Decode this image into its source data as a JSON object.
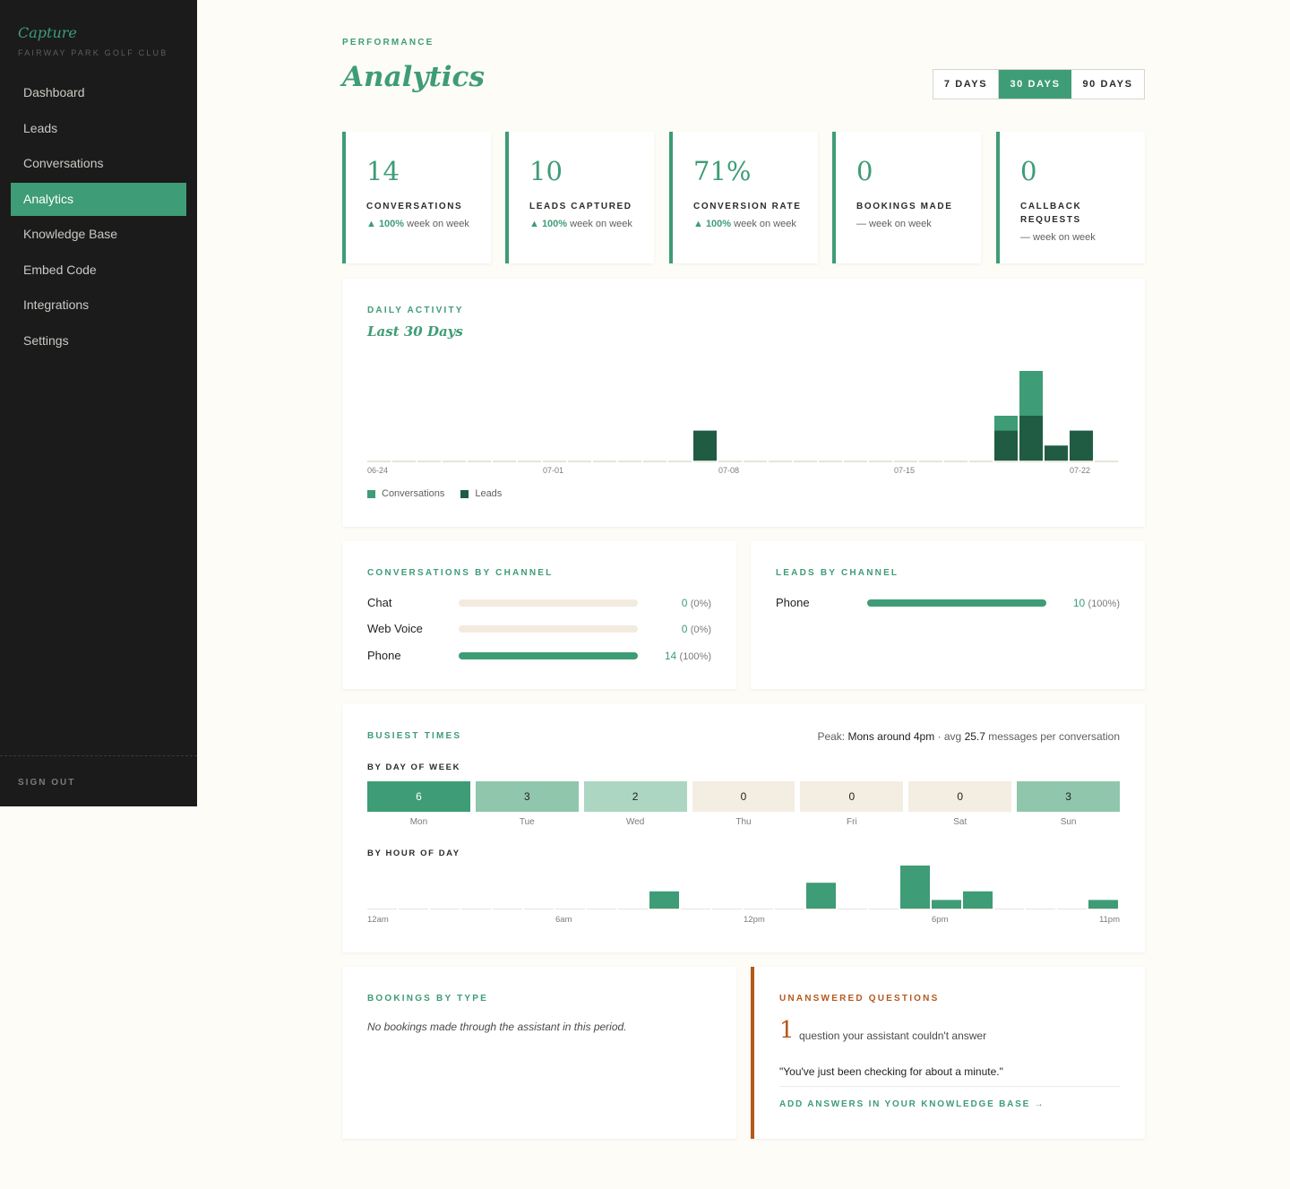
{
  "sidebar": {
    "brand": "Capture",
    "club": "FAIRWAY PARK GOLF CLUB",
    "items": [
      {
        "label": "Dashboard"
      },
      {
        "label": "Leads"
      },
      {
        "label": "Conversations"
      },
      {
        "label": "Analytics",
        "active": true
      },
      {
        "label": "Knowledge Base"
      },
      {
        "label": "Embed Code"
      },
      {
        "label": "Integrations"
      },
      {
        "label": "Settings"
      }
    ],
    "sign_out": "SIGN OUT"
  },
  "header": {
    "eyebrow": "PERFORMANCE",
    "title": "Analytics",
    "ranges": [
      "7 DAYS",
      "30 DAYS",
      "90 DAYS"
    ],
    "selected_range": "30 DAYS"
  },
  "stats": [
    {
      "value": "14",
      "label": "CONVERSATIONS",
      "delta": "▲ 100%",
      "delta_suffix": " week on week"
    },
    {
      "value": "10",
      "label": "LEADS CAPTURED",
      "delta": "▲ 100%",
      "delta_suffix": " week on week"
    },
    {
      "value": "71%",
      "label": "CONVERSION RATE",
      "delta": "▲ 100%",
      "delta_suffix": " week on week"
    },
    {
      "value": "0",
      "label": "BOOKINGS MADE",
      "delta": "",
      "delta_suffix": "— week on week"
    },
    {
      "value": "0",
      "label": "CALLBACK REQUESTS",
      "delta": "",
      "delta_suffix": "— week on week"
    }
  ],
  "daily": {
    "eyebrow": "DAILY ACTIVITY",
    "subtitle": "Last 30 Days",
    "legend": {
      "conversations": "Conversations",
      "leads": "Leads"
    }
  },
  "conv_channel": {
    "eyebrow": "CONVERSATIONS BY CHANNEL",
    "rows": [
      {
        "name": "Chat",
        "count": "0",
        "pct": "(0%)",
        "fraction": 0
      },
      {
        "name": "Web Voice",
        "count": "0",
        "pct": "(0%)",
        "fraction": 0
      },
      {
        "name": "Phone",
        "count": "14",
        "pct": "(100%)",
        "fraction": 1
      }
    ]
  },
  "lead_channel": {
    "eyebrow": "LEADS BY CHANNEL",
    "rows": [
      {
        "name": "Phone",
        "count": "10",
        "pct": "(100%)",
        "fraction": 1
      }
    ]
  },
  "busy": {
    "eyebrow": "BUSIEST TIMES",
    "peak_prefix": "Peak: ",
    "peak_value": "Mons around 4pm",
    "peak_mid": " · avg ",
    "peak_avg": "25.7",
    "peak_suffix": " messages per conversation",
    "dow_label": "BY DAY OF WEEK",
    "days": [
      {
        "label": "Mon",
        "value": "6"
      },
      {
        "label": "Tue",
        "value": "3"
      },
      {
        "label": "Wed",
        "value": "2"
      },
      {
        "label": "Thu",
        "value": "0"
      },
      {
        "label": "Fri",
        "value": "0"
      },
      {
        "label": "Sat",
        "value": "0"
      },
      {
        "label": "Sun",
        "value": "3"
      }
    ],
    "hod_label": "BY HOUR OF DAY"
  },
  "bookings": {
    "eyebrow": "BOOKINGS BY TYPE",
    "empty": "No bookings made through the assistant in this period."
  },
  "unanswered": {
    "eyebrow": "UNANSWERED QUESTIONS",
    "count": "1",
    "desc": "question your assistant couldn't answer",
    "question": "\"You've just been checking for about a minute.\"",
    "link": "ADD ANSWERS IN YOUR KNOWLEDGE BASE →"
  },
  "colors": {
    "accent": "#3e9c76",
    "dark_accent": "#1f5c43",
    "warning": "#b5581c",
    "sidebar_bg": "#1b1b1b",
    "page_bg": "#fdfcf7"
  },
  "chart_data": [
    {
      "type": "bar",
      "title": "Last 30 Days",
      "categories": [
        "06-24",
        "06-25",
        "06-26",
        "06-27",
        "06-28",
        "06-29",
        "06-30",
        "07-01",
        "07-02",
        "07-03",
        "07-04",
        "07-05",
        "07-06",
        "07-07",
        "07-08",
        "07-09",
        "07-10",
        "07-11",
        "07-12",
        "07-13",
        "07-14",
        "07-15",
        "07-16",
        "07-17",
        "07-18",
        "07-19",
        "07-20",
        "07-21",
        "07-22",
        "07-23"
      ],
      "tick_labels": [
        "06-24",
        "07-01",
        "07-08",
        "07-15",
        "07-22"
      ],
      "series": [
        {
          "name": "Conversations",
          "values": [
            0,
            0,
            0,
            0,
            0,
            0,
            0,
            0,
            0,
            0,
            0,
            0,
            0,
            2,
            0,
            0,
            0,
            0,
            0,
            0,
            0,
            0,
            0,
            0,
            0,
            3,
            6,
            1,
            2,
            0
          ]
        },
        {
          "name": "Leads",
          "values": [
            0,
            0,
            0,
            0,
            0,
            0,
            0,
            0,
            0,
            0,
            0,
            0,
            0,
            2,
            0,
            0,
            0,
            0,
            0,
            0,
            0,
            0,
            0,
            0,
            0,
            2,
            3,
            1,
            2,
            0
          ]
        }
      ],
      "legend": "bottom-left"
    },
    {
      "type": "bar",
      "title": "BY HOUR OF DAY",
      "categories": [
        "12am",
        "1am",
        "2am",
        "3am",
        "4am",
        "5am",
        "6am",
        "7am",
        "8am",
        "9am",
        "10am",
        "11am",
        "12pm",
        "1pm",
        "2pm",
        "3pm",
        "4pm",
        "5pm",
        "6pm",
        "7pm",
        "8pm",
        "9pm",
        "10pm",
        "11pm"
      ],
      "tick_labels": [
        "12am",
        "6am",
        "12pm",
        "6pm",
        "11pm"
      ],
      "values": [
        0,
        0,
        0,
        0,
        0,
        0,
        0,
        0,
        0,
        2,
        0,
        0,
        0,
        0,
        3,
        0,
        0,
        5,
        1,
        2,
        0,
        0,
        0,
        1
      ]
    }
  ]
}
